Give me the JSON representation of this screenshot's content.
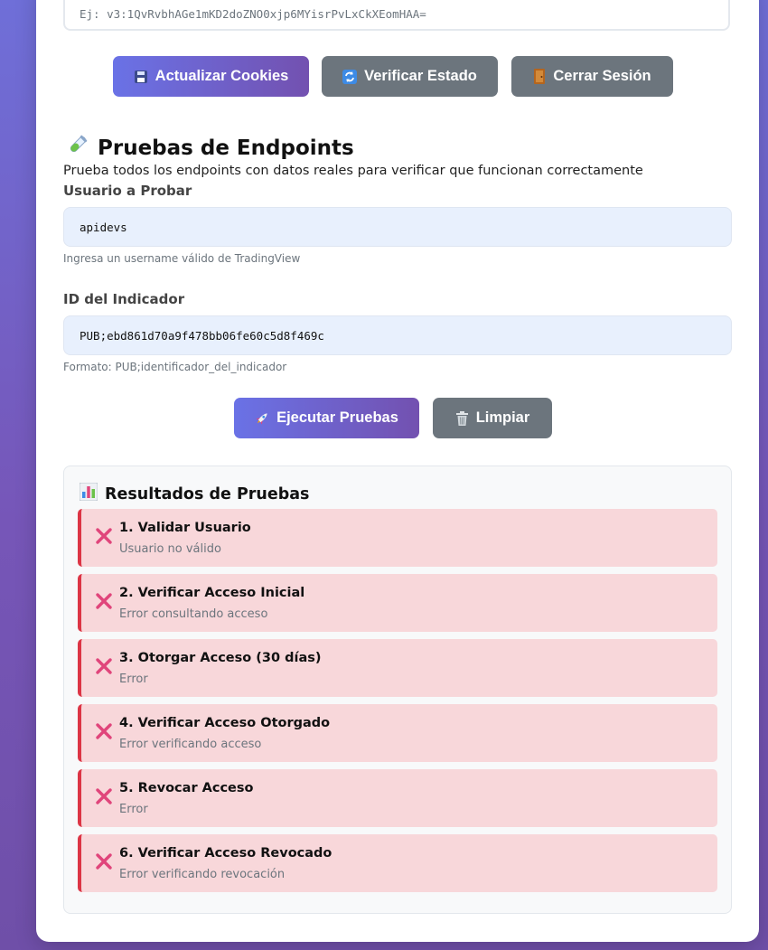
{
  "cookie": {
    "placeholder": "Ej: v3:1QvRvbhAGe1mKD2doZNO0xjp6MYisrPvLxCkXEomHAA="
  },
  "cookie_buttons": {
    "update": "Actualizar Cookies",
    "verify": "Verificar Estado",
    "logout": "Cerrar Sesión"
  },
  "tests": {
    "title": "Pruebas de Endpoints",
    "description": "Prueba todos los endpoints con datos reales para verificar que funcionan correctamente",
    "user": {
      "label": "Usuario a Probar",
      "value": "apidevs",
      "help": "Ingresa un username válido de TradingView"
    },
    "indicator": {
      "label": "ID del Indicador",
      "value": "PUB;ebd861d70a9f478bb06fe60c5d8f469c",
      "help": "Formato: PUB;identificador_del_indicador"
    },
    "run_label": "Ejecutar Pruebas",
    "clear_label": "Limpiar"
  },
  "results": {
    "title": "Resultados de Pruebas",
    "items": [
      {
        "title": "1. Validar Usuario",
        "message": "Usuario no válido",
        "status": "error"
      },
      {
        "title": "2. Verificar Acceso Inicial",
        "message": "Error consultando acceso",
        "status": "error"
      },
      {
        "title": "3. Otorgar Acceso (30 días)",
        "message": "Error",
        "status": "error"
      },
      {
        "title": "4. Verificar Acceso Otorgado",
        "message": "Error verificando acceso",
        "status": "error"
      },
      {
        "title": "5. Revocar Acceso",
        "message": "Error",
        "status": "error"
      },
      {
        "title": "6. Verificar Acceso Revocado",
        "message": "Error verificando revocación",
        "status": "error"
      }
    ]
  },
  "colors": {
    "accent_start": "#6a72e6",
    "accent_end": "#7351b0",
    "secondary": "#6c757d",
    "error_bg": "#f8d7da",
    "error_border": "#dc3545",
    "error_icon": "#e0457b"
  },
  "icons": {
    "update": "floppy-disk-icon",
    "verify": "refresh-icon",
    "logout": "door-icon",
    "tests": "test-tube-icon",
    "run": "rocket-icon",
    "clear": "trash-icon",
    "results": "bar-chart-icon",
    "result_status": "cross-mark-icon"
  }
}
